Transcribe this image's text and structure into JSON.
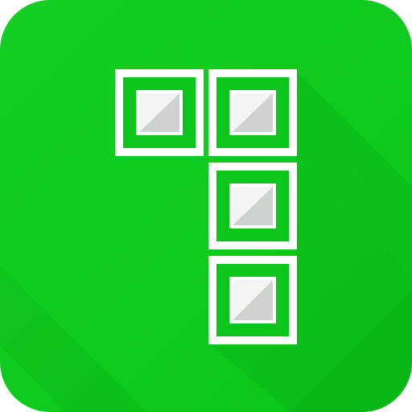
{
  "icon": {
    "name": "tetromino-l-icon",
    "colors": {
      "tile": "#0bc51a",
      "tile_light": "#14cf24",
      "tile_dark": "#08ad14",
      "frame": "#ffffff",
      "block_light": "#f4f4f4",
      "block_dark": "#cfd3cf"
    }
  }
}
